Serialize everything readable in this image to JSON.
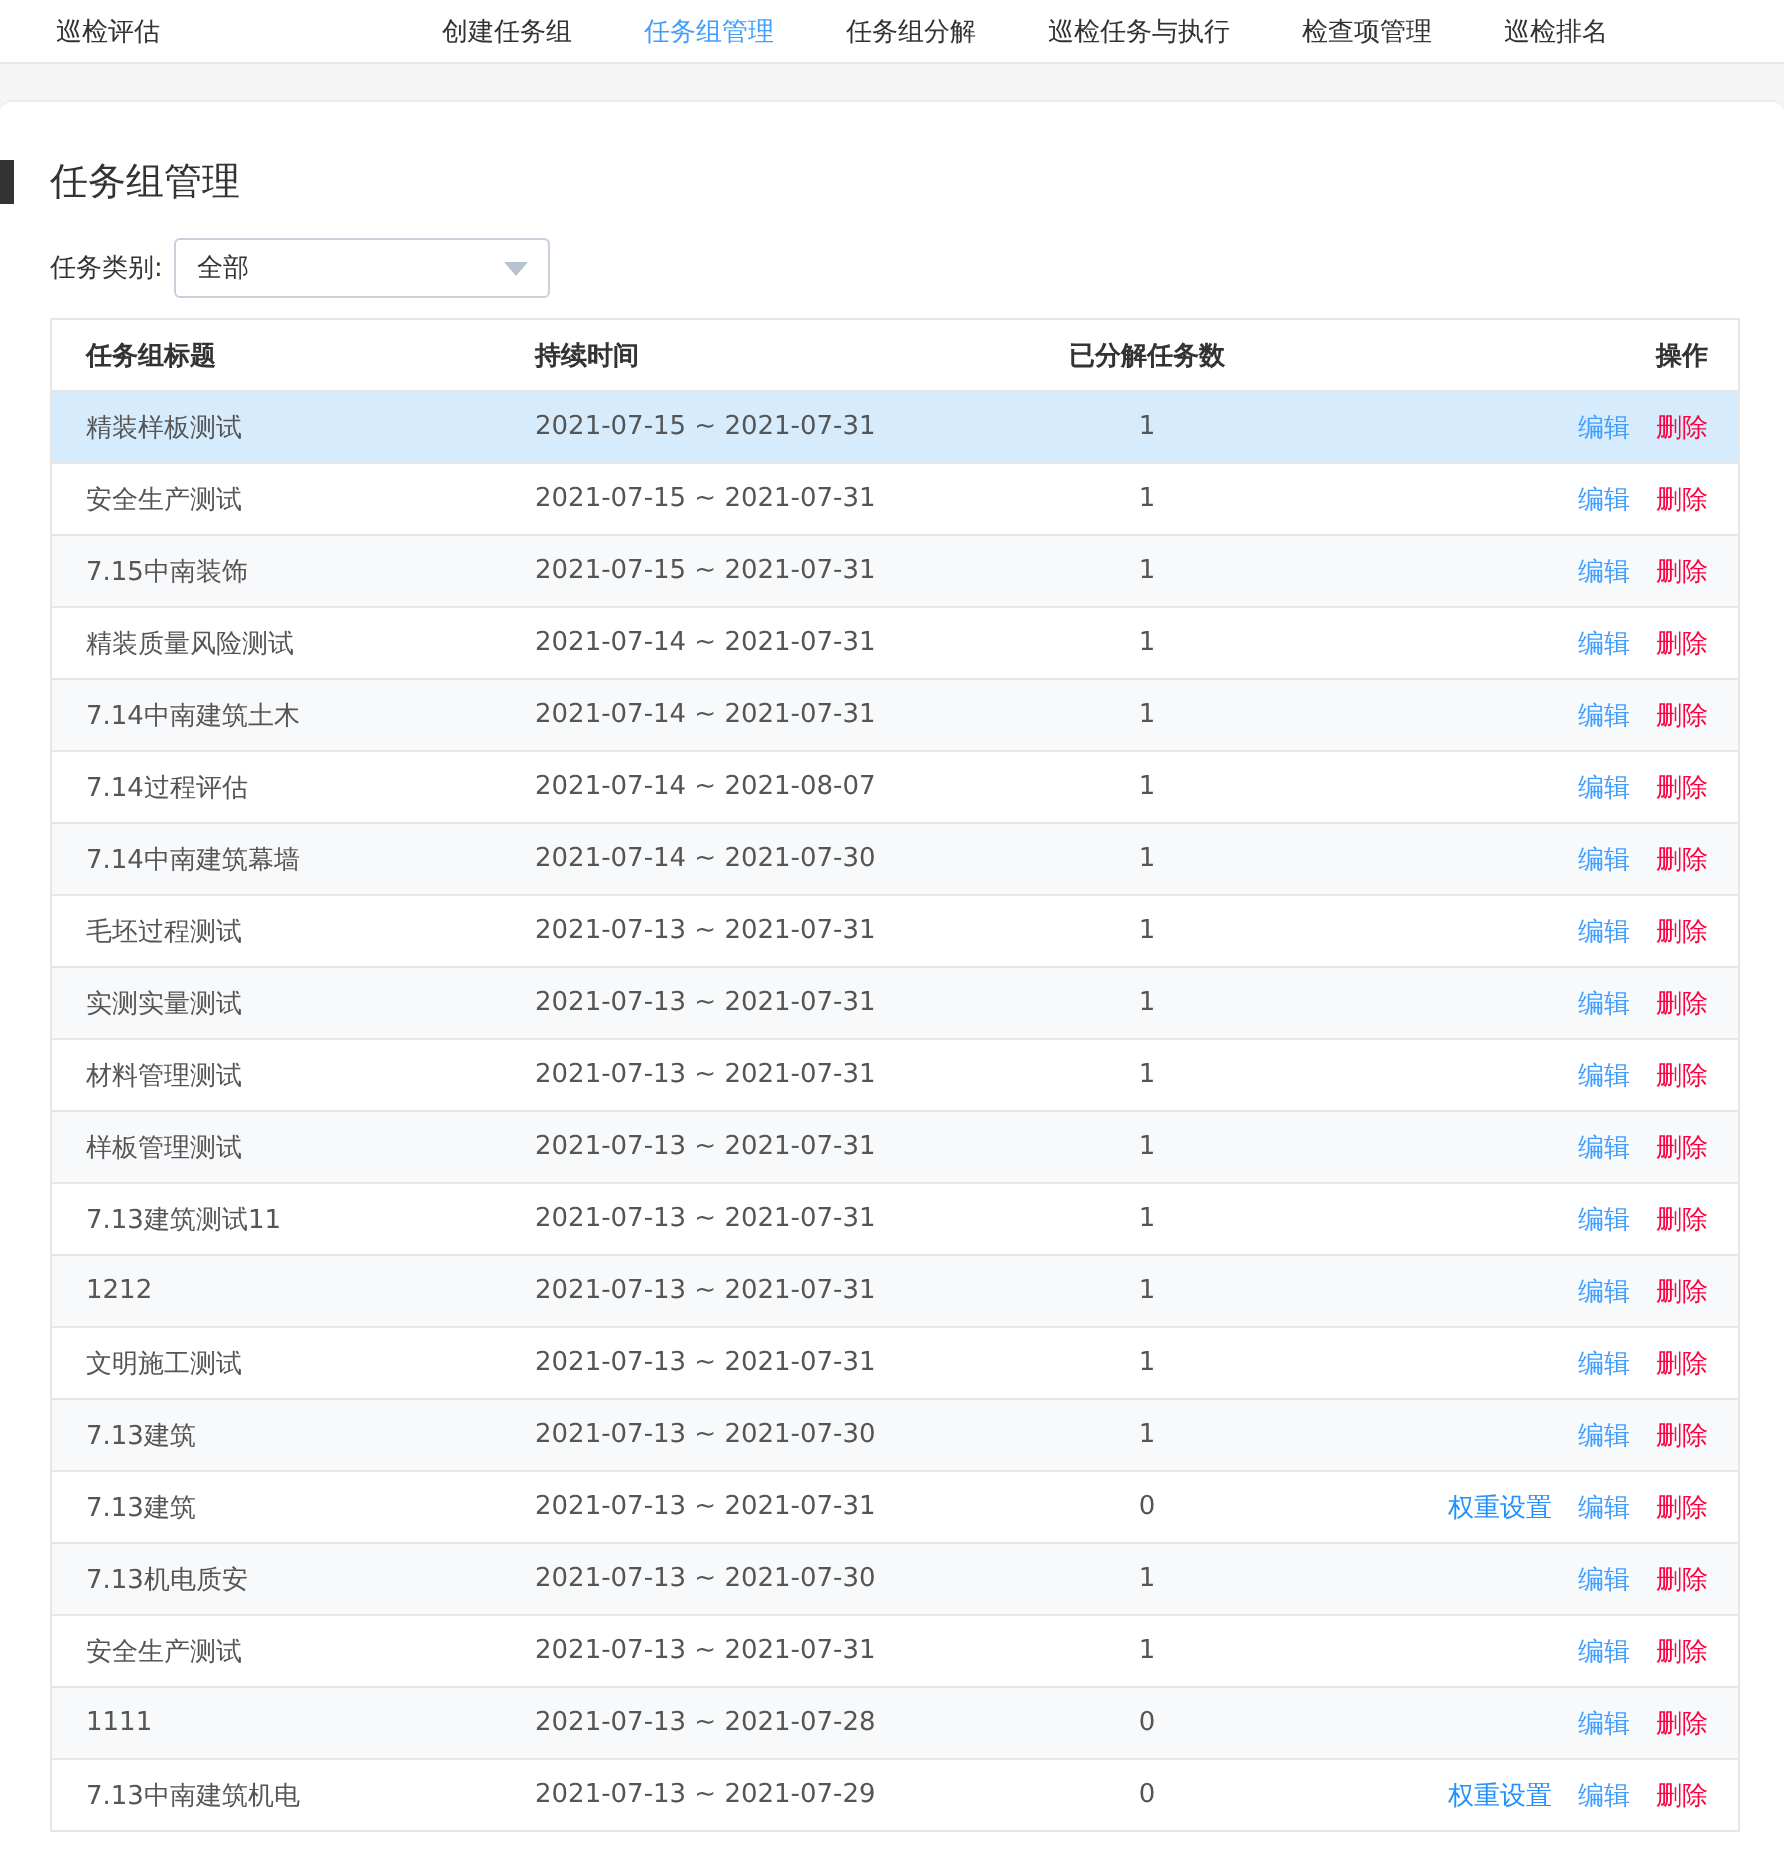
{
  "nav": {
    "brand": "巡检评估",
    "items": [
      {
        "label": "创建任务组",
        "selected": false
      },
      {
        "label": "任务组管理",
        "selected": true
      },
      {
        "label": "任务组分解",
        "selected": false
      },
      {
        "label": "巡检任务与执行",
        "selected": false
      },
      {
        "label": "检查项管理",
        "selected": false
      },
      {
        "label": "巡检排名",
        "selected": false
      }
    ]
  },
  "page_title": "任务组管理",
  "filter": {
    "label": "任务类别:",
    "value": "全部"
  },
  "table": {
    "columns": [
      "任务组标题",
      "持续时间",
      "已分解任务数",
      "操作"
    ],
    "rows": [
      {
        "title": "精装样板测试",
        "duration": "2021-07-15 ~ 2021-07-31",
        "count": "1",
        "selected": true,
        "actions": [
          {
            "kind": "edit",
            "label": "编辑"
          },
          {
            "kind": "delete",
            "label": "删除"
          }
        ]
      },
      {
        "title": "安全生产测试",
        "duration": "2021-07-15 ~ 2021-07-31",
        "count": "1",
        "selected": false,
        "actions": [
          {
            "kind": "edit",
            "label": "编辑"
          },
          {
            "kind": "delete",
            "label": "删除"
          }
        ]
      },
      {
        "title": "7.15中南装饰",
        "duration": "2021-07-15 ~ 2021-07-31",
        "count": "1",
        "selected": false,
        "actions": [
          {
            "kind": "edit",
            "label": "编辑"
          },
          {
            "kind": "delete",
            "label": "删除"
          }
        ]
      },
      {
        "title": "精装质量风险测试",
        "duration": "2021-07-14 ~ 2021-07-31",
        "count": "1",
        "selected": false,
        "actions": [
          {
            "kind": "edit",
            "label": "编辑"
          },
          {
            "kind": "delete",
            "label": "删除"
          }
        ]
      },
      {
        "title": "7.14中南建筑土木",
        "duration": "2021-07-14 ~ 2021-07-31",
        "count": "1",
        "selected": false,
        "actions": [
          {
            "kind": "edit",
            "label": "编辑"
          },
          {
            "kind": "delete",
            "label": "删除"
          }
        ]
      },
      {
        "title": "7.14过程评估",
        "duration": "2021-07-14 ~ 2021-08-07",
        "count": "1",
        "selected": false,
        "actions": [
          {
            "kind": "edit",
            "label": "编辑"
          },
          {
            "kind": "delete",
            "label": "删除"
          }
        ]
      },
      {
        "title": "7.14中南建筑幕墙",
        "duration": "2021-07-14 ~ 2021-07-30",
        "count": "1",
        "selected": false,
        "actions": [
          {
            "kind": "edit",
            "label": "编辑"
          },
          {
            "kind": "delete",
            "label": "删除"
          }
        ]
      },
      {
        "title": "毛坯过程测试",
        "duration": "2021-07-13 ~ 2021-07-31",
        "count": "1",
        "selected": false,
        "actions": [
          {
            "kind": "edit",
            "label": "编辑"
          },
          {
            "kind": "delete",
            "label": "删除"
          }
        ]
      },
      {
        "title": "实测实量测试",
        "duration": "2021-07-13 ~ 2021-07-31",
        "count": "1",
        "selected": false,
        "actions": [
          {
            "kind": "edit",
            "label": "编辑"
          },
          {
            "kind": "delete",
            "label": "删除"
          }
        ]
      },
      {
        "title": "材料管理测试",
        "duration": "2021-07-13 ~ 2021-07-31",
        "count": "1",
        "selected": false,
        "actions": [
          {
            "kind": "edit",
            "label": "编辑"
          },
          {
            "kind": "delete",
            "label": "删除"
          }
        ]
      },
      {
        "title": "样板管理测试",
        "duration": "2021-07-13 ~ 2021-07-31",
        "count": "1",
        "selected": false,
        "actions": [
          {
            "kind": "edit",
            "label": "编辑"
          },
          {
            "kind": "delete",
            "label": "删除"
          }
        ]
      },
      {
        "title": "7.13建筑测试11",
        "duration": "2021-07-13 ~ 2021-07-31",
        "count": "1",
        "selected": false,
        "actions": [
          {
            "kind": "edit",
            "label": "编辑"
          },
          {
            "kind": "delete",
            "label": "删除"
          }
        ]
      },
      {
        "title": "1212",
        "duration": "2021-07-13 ~ 2021-07-31",
        "count": "1",
        "selected": false,
        "actions": [
          {
            "kind": "edit",
            "label": "编辑"
          },
          {
            "kind": "delete",
            "label": "删除"
          }
        ]
      },
      {
        "title": "文明施工测试",
        "duration": "2021-07-13 ~ 2021-07-31",
        "count": "1",
        "selected": false,
        "actions": [
          {
            "kind": "edit",
            "label": "编辑"
          },
          {
            "kind": "delete",
            "label": "删除"
          }
        ]
      },
      {
        "title": "7.13建筑",
        "duration": "2021-07-13 ~ 2021-07-30",
        "count": "1",
        "selected": false,
        "actions": [
          {
            "kind": "edit",
            "label": "编辑"
          },
          {
            "kind": "delete",
            "label": "删除"
          }
        ]
      },
      {
        "title": "7.13建筑",
        "duration": "2021-07-13 ~ 2021-07-31",
        "count": "0",
        "selected": false,
        "actions": [
          {
            "kind": "weight",
            "label": "权重设置"
          },
          {
            "kind": "edit",
            "label": "编辑"
          },
          {
            "kind": "delete",
            "label": "删除"
          }
        ]
      },
      {
        "title": "7.13机电质安",
        "duration": "2021-07-13 ~ 2021-07-30",
        "count": "1",
        "selected": false,
        "actions": [
          {
            "kind": "edit",
            "label": "编辑"
          },
          {
            "kind": "delete",
            "label": "删除"
          }
        ]
      },
      {
        "title": "安全生产测试",
        "duration": "2021-07-13 ~ 2021-07-31",
        "count": "1",
        "selected": false,
        "actions": [
          {
            "kind": "edit",
            "label": "编辑"
          },
          {
            "kind": "delete",
            "label": "删除"
          }
        ]
      },
      {
        "title": "1111",
        "duration": "2021-07-13 ~ 2021-07-28",
        "count": "0",
        "selected": false,
        "actions": [
          {
            "kind": "edit",
            "label": "编辑"
          },
          {
            "kind": "delete",
            "label": "删除"
          }
        ]
      },
      {
        "title": "7.13中南建筑机电",
        "duration": "2021-07-13 ~ 2021-07-29",
        "count": "0",
        "selected": false,
        "actions": [
          {
            "kind": "weight",
            "label": "权重设置"
          },
          {
            "kind": "edit",
            "label": "编辑"
          },
          {
            "kind": "delete",
            "label": "删除"
          }
        ]
      }
    ]
  }
}
